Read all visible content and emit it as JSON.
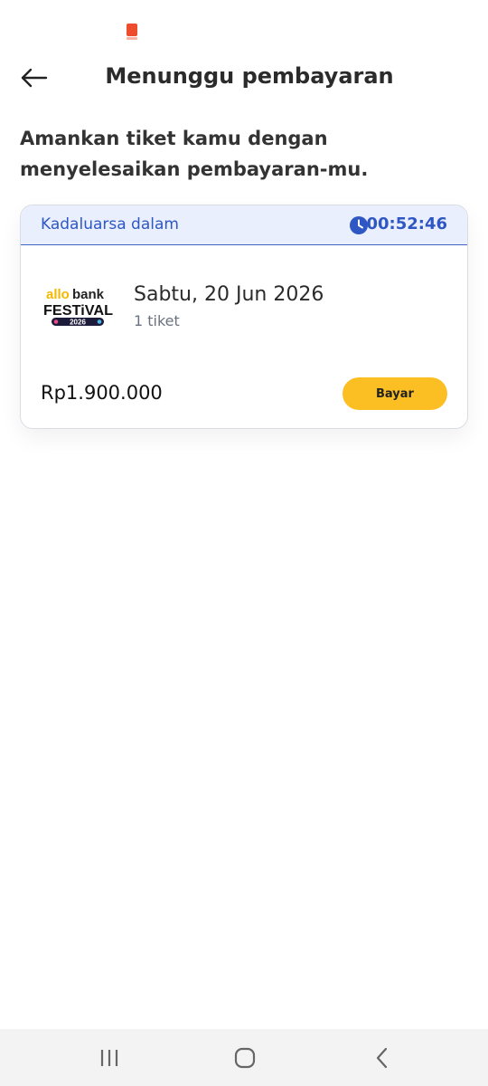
{
  "status_bar": {
    "app_icon": "shopee-pay-icon"
  },
  "header": {
    "back_icon": "arrow-left-icon",
    "title": "Menunggu pembayaran"
  },
  "intro_text": "Amankan tiket kamu dengan menyelesaikan pembayaran-mu.",
  "order": {
    "expiry_label": "Kadaluarsa dalam",
    "expiry_icon": "clock-icon",
    "countdown": "00:52:46",
    "event_logo": {
      "line1_allo": "allo",
      "line1_bank": "bank",
      "line2": "FESTiVAL",
      "line3": "2026"
    },
    "date": "Sabtu, 20 Jun 2026",
    "ticket_count": "1 tiket",
    "price": "Rp1.900.000",
    "pay_label": "Bayar"
  },
  "colors": {
    "accent_blue": "#2f57c4",
    "expiry_bg": "#e9effd",
    "pay_button": "#fbbf24",
    "allo_yellow": "#f5b800"
  },
  "nav_bar": {
    "recents_icon": "recents-icon",
    "home_icon": "home-icon",
    "back_icon": "nav-back-icon"
  }
}
